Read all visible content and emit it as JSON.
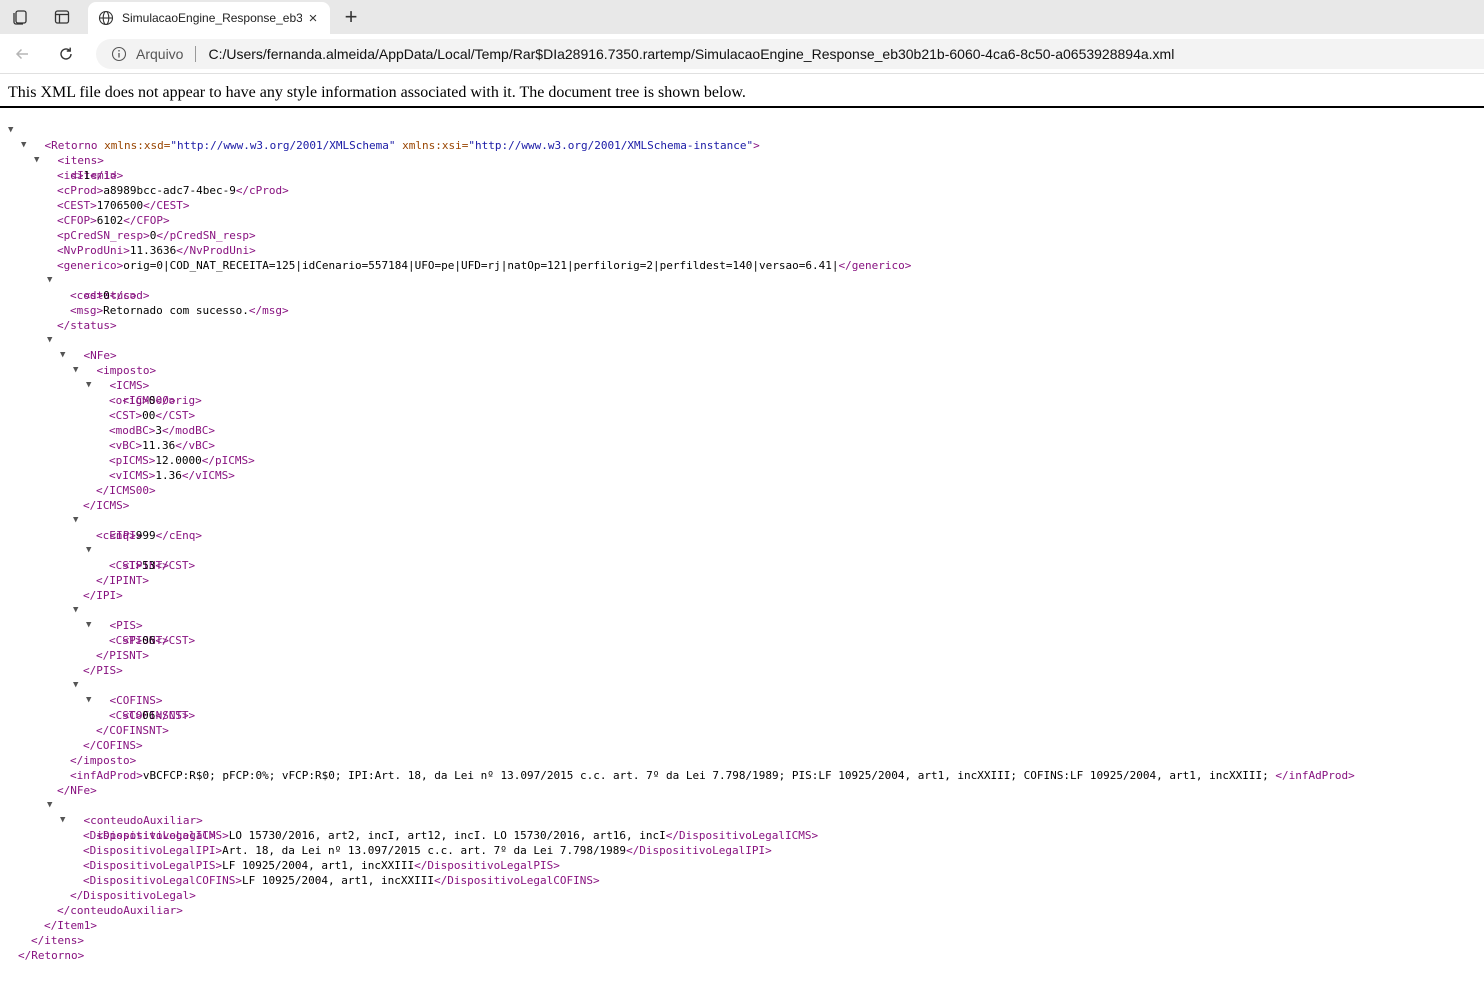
{
  "browser": {
    "tab_title": "SimulacaoEngine_Response_eb30b21b-6060-4ca6-8c50-a0653928894a.xml",
    "close_glyph": "×",
    "newtab_glyph": "+",
    "scheme_label": "Arquivo",
    "url": "C:/Users/fernanda.almeida/AppData/Local/Temp/Rar$DIa28916.7350.rartemp/SimulacaoEngine_Response_eb30b21b-6060-4ca6-8c50-a0653928894a.xml"
  },
  "page": {
    "banner": "This XML file does not appear to have any style information associated with it. The document tree is shown below."
  },
  "xml": {
    "root_open_name": "<Retorno",
    "xsd_attr": " xmlns:xsd=",
    "xsd_val": "\"http://www.w3.org/2001/XMLSchema\"",
    "xsi_attr": " xmlns:xsi=",
    "xsi_val": "\"http://www.w3.org/2001/XMLSchema-instance\"",
    "root_open_end": ">",
    "itens_open": "<itens>",
    "item1_open": "<Item1>",
    "id": {
      "open": "<id>",
      "value": "1",
      "close": "</id>"
    },
    "cProd": {
      "open": "<cProd>",
      "value": "a8989bcc-adc7-4bec-9",
      "close": "</cProd>"
    },
    "CEST": {
      "open": "<CEST>",
      "value": "1706500",
      "close": "</CEST>"
    },
    "CFOP": {
      "open": "<CFOP>",
      "value": "6102",
      "close": "</CFOP>"
    },
    "pCredSN_resp": {
      "open": "<pCredSN_resp>",
      "value": "0",
      "close": "</pCredSN_resp>"
    },
    "NvProdUni": {
      "open": "<NvProdUni>",
      "value": "11.3636",
      "close": "</NvProdUni>"
    },
    "generico": {
      "open": "<generico>",
      "value": "orig=0|COD_NAT_RECEITA=125|idCenario=557184|UFO=pe|UFD=rj|natOp=121|perfilorig=2|perfildest=140|versao=6.41|",
      "close": "</generico>"
    },
    "status_open": "<status>",
    "cod": {
      "open": "<cod>",
      "value": "0",
      "close": "</cod>"
    },
    "msg": {
      "open": "<msg>",
      "value": "Retornado com sucesso.",
      "close": "</msg>"
    },
    "status_close": "</status>",
    "nfe_open": "<NFe>",
    "imposto_open": "<imposto>",
    "icms_open": "<ICMS>",
    "icms00_open": "<ICMS00>",
    "orig": {
      "open": "<orig>",
      "value": "0",
      "close": "</orig>"
    },
    "icms_cst": {
      "open": "<CST>",
      "value": "00",
      "close": "</CST>"
    },
    "modBC": {
      "open": "<modBC>",
      "value": "3",
      "close": "</modBC>"
    },
    "vBC": {
      "open": "<vBC>",
      "value": "11.36",
      "close": "</vBC>"
    },
    "pICMS": {
      "open": "<pICMS>",
      "value": "12.0000",
      "close": "</pICMS>"
    },
    "vICMS": {
      "open": "<vICMS>",
      "value": "1.36",
      "close": "</vICMS>"
    },
    "icms00_close": "</ICMS00>",
    "icms_close": "</ICMS>",
    "ipi_open": "<IPI>",
    "cEnq": {
      "open": "<cEnq>",
      "value": "999",
      "close": "</cEnq>"
    },
    "ipint_open": "<IPINT>",
    "ipi_cst": {
      "open": "<CST>",
      "value": "53",
      "close": "</CST>"
    },
    "ipint_close": "</IPINT>",
    "ipi_close": "</IPI>",
    "pis_open": "<PIS>",
    "pisnt_open": "<PISNT>",
    "pis_cst": {
      "open": "<CST>",
      "value": "06",
      "close": "</CST>"
    },
    "pisnt_close": "</PISNT>",
    "pis_close": "</PIS>",
    "cofins_open": "<COFINS>",
    "cofinsnt_open": "<COFINSNT>",
    "cofins_cst": {
      "open": "<CST>",
      "value": "06",
      "close": "</CST>"
    },
    "cofinsnt_close": "</COFINSNT>",
    "cofins_close": "</COFINS>",
    "imposto_close": "</imposto>",
    "infAdProd": {
      "open": "<infAdProd>",
      "value": "vBCFCP:R$0; pFCP:0%; vFCP:R$0; IPI:Art. 18, da Lei nº 13.097/2015 c.c. art. 7º da Lei 7.798/1989; PIS:LF 10925/2004, art1, incXXIII; COFINS:LF 10925/2004, art1, incXXIII; ",
      "close": "</infAdProd>"
    },
    "nfe_close": "</NFe>",
    "conteudo_open": "<conteudoAuxiliar>",
    "dispositivo_open": "<DispositivoLegal>",
    "dl_icms": {
      "open": "<DispositivoLegalICMS>",
      "value": "LO 15730/2016, art2, incI, art12, incI. LO 15730/2016, art16, incI",
      "close": "</DispositivoLegalICMS>"
    },
    "dl_ipi": {
      "open": "<DispositivoLegalIPI>",
      "value": "Art. 18, da Lei nº 13.097/2015 c.c. art. 7º da Lei 7.798/1989",
      "close": "</DispositivoLegalIPI>"
    },
    "dl_pis": {
      "open": "<DispositivoLegalPIS>",
      "value": "LF 10925/2004, art1, incXXIII",
      "close": "</DispositivoLegalPIS>"
    },
    "dl_cofins": {
      "open": "<DispositivoLegalCOFINS>",
      "value": "LF 10925/2004, art1, incXXIII",
      "close": "</DispositivoLegalCOFINS>"
    },
    "dispositivo_close": "</DispositivoLegal>",
    "conteudo_close": "</conteudoAuxiliar>",
    "item1_close": "</Item1>",
    "itens_close": "</itens>",
    "root_close": "</Retorno>"
  },
  "colors": {
    "tag": "#881280",
    "attribute": "#994500",
    "attribute_value": "#1a1aa6",
    "text": "#000000"
  },
  "icons": [
    "workspaces-icon",
    "vertical-tabs-icon",
    "globe-icon",
    "close-icon",
    "new-tab-icon",
    "back-icon",
    "reload-icon",
    "info-icon",
    "collapse-arrow-icon"
  ]
}
